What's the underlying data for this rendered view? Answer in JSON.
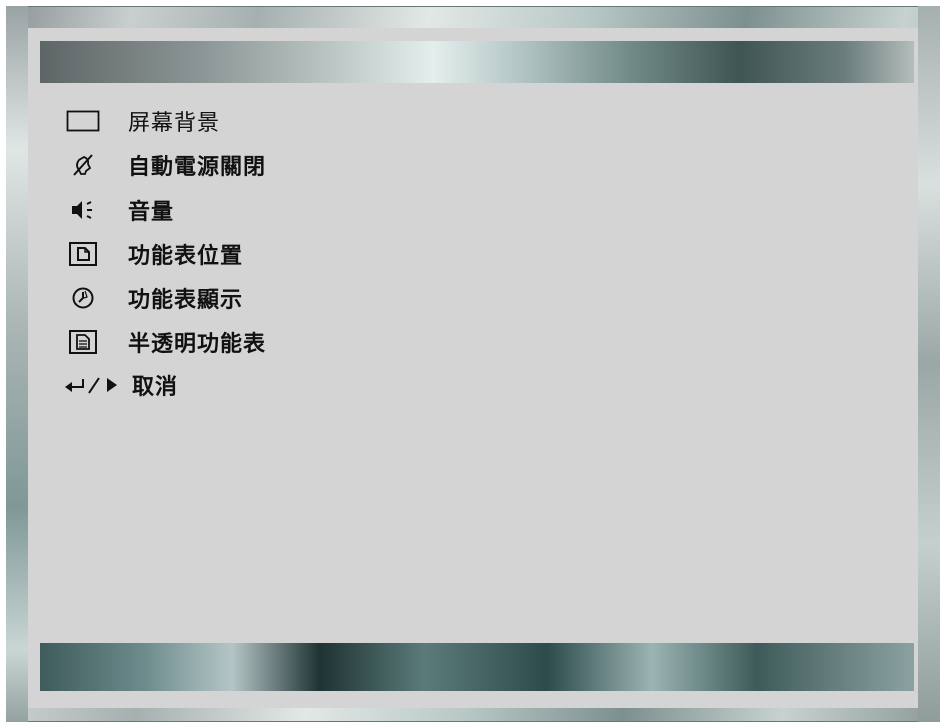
{
  "menu": {
    "items": [
      {
        "label": "屏幕背景",
        "icon": "screen-background-icon"
      },
      {
        "label": "自動電源關閉",
        "icon": "auto-power-off-icon"
      },
      {
        "label": "音量",
        "icon": "volume-icon"
      },
      {
        "label": "功能表位置",
        "icon": "menu-position-icon"
      },
      {
        "label": "功能表顯示",
        "icon": "menu-display-timer-icon"
      },
      {
        "label": "半透明功能表",
        "icon": "translucent-menu-icon"
      },
      {
        "label": "取消",
        "icon": "enter-right-icon"
      }
    ]
  },
  "colors": {
    "panel": "#d4d4d4",
    "text": "#111111",
    "frame_accent": "#7c908f"
  }
}
